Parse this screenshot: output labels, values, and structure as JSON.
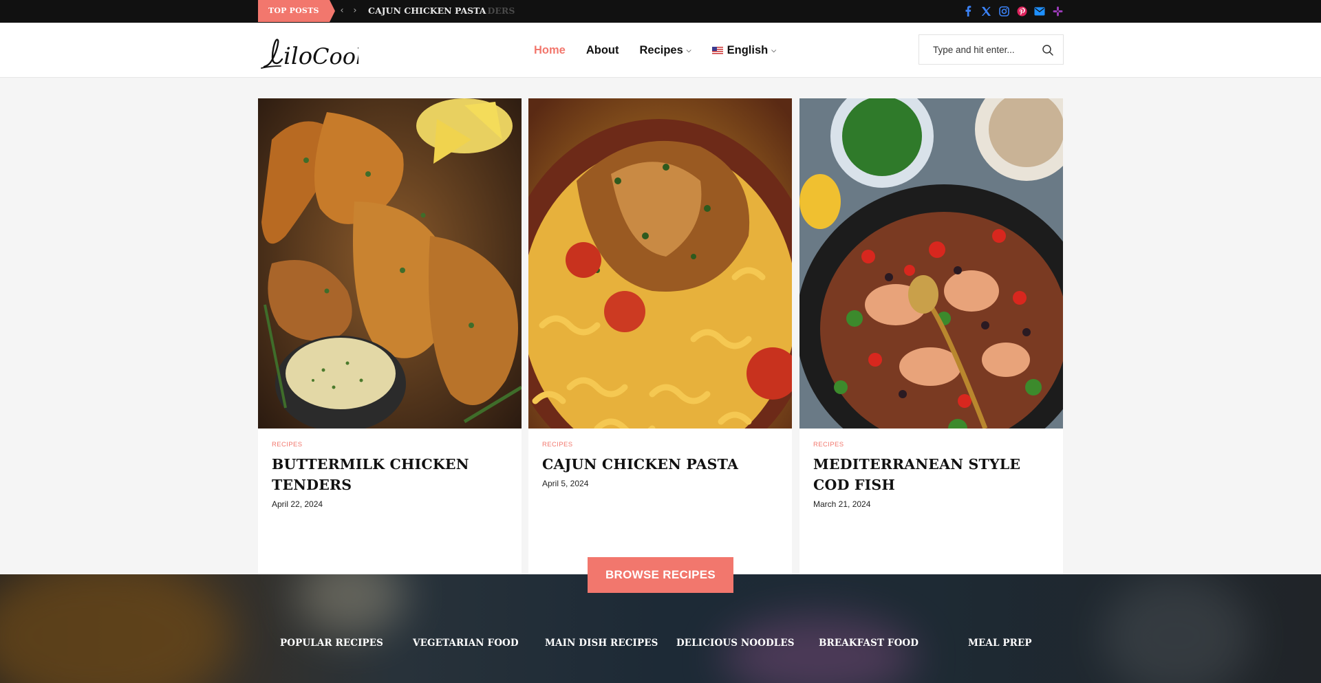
{
  "topbar": {
    "badge": "TOP POSTS",
    "ticker_current": "CAJUN CHICKEN PASTA",
    "ticker_previous": "BUTTERMILK CHICKEN TENDERS",
    "ticker_ghost": "EN TENDERS",
    "socials": [
      "facebook-icon",
      "x-icon",
      "instagram-icon",
      "pinterest-icon",
      "email-icon",
      "slack-icon"
    ]
  },
  "header": {
    "logo_text": "liloCook",
    "nav": [
      {
        "label": "Home",
        "active": true
      },
      {
        "label": "About"
      },
      {
        "label": "Recipes",
        "dropdown": true
      },
      {
        "label": "English",
        "dropdown": true
      }
    ],
    "search_placeholder": "Type and hit enter..."
  },
  "cards": [
    {
      "category": "RECIPES",
      "title": "BUTTERMILK CHICKEN TENDERS",
      "date": "April 22, 2024"
    },
    {
      "category": "RECIPES",
      "title": "CAJUN CHICKEN PASTA",
      "date": "April 5, 2024"
    },
    {
      "category": "RECIPES",
      "title": "MEDITERRANEAN STYLE COD FISH",
      "date": "March 21, 2024"
    }
  ],
  "browse_label": "BROWSE RECIPES",
  "categories": [
    "POPULAR RECIPES",
    "VEGETARIAN FOOD",
    "MAIN DISH RECIPES",
    "DELICIOUS NOODLES",
    "BREAKFAST FOOD",
    "MEAL PREP"
  ],
  "colors": {
    "accent": "#f2776d",
    "topbar": "#111111",
    "page_bg": "#f5f5f5"
  }
}
